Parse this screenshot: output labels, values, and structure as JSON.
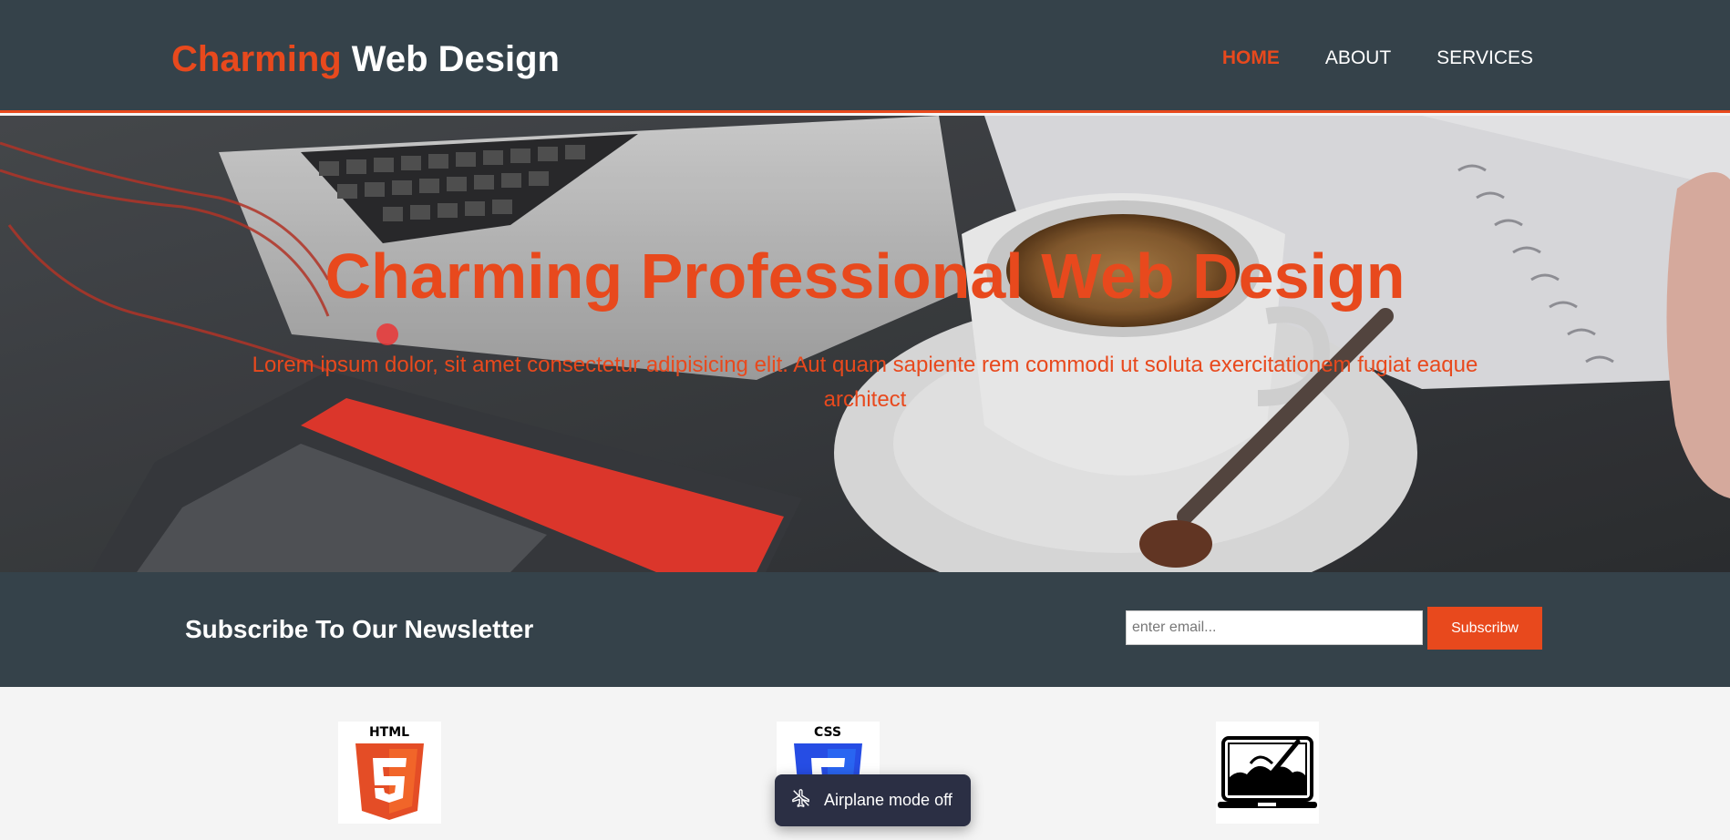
{
  "header": {
    "brand_accent": "Charming",
    "brand_rest": " Web Design",
    "nav": [
      {
        "label": "HOME",
        "current": true
      },
      {
        "label": "ABOUT",
        "current": false
      },
      {
        "label": "SERVICES",
        "current": false
      }
    ]
  },
  "hero": {
    "title": "Charming Professional Web Design",
    "text": "Lorem ipsum dolor, sit amet consectetur adipisicing elit. Aut quam sapiente rem commodi ut soluta exercitationem fugiat eaque architect"
  },
  "newsletter": {
    "heading": "Subscribe To Our Newsletter",
    "email_placeholder": "enter email...",
    "email_value": "",
    "button_label": "Subscribw"
  },
  "boxes": [
    {
      "icon": "html5-icon",
      "label": "HTML"
    },
    {
      "icon": "css3-icon",
      "label": "CSS"
    },
    {
      "icon": "graphic-design-icon"
    }
  ],
  "toast": {
    "icon": "airplane-icon",
    "text": "Airplane mode off"
  },
  "colors": {
    "accent": "#e8491d",
    "dark": "#35424a",
    "light": "#f4f4f4"
  }
}
